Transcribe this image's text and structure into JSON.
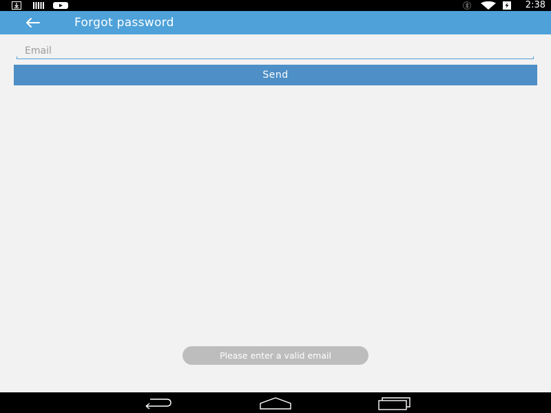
{
  "status_bar": {
    "time": "2:38",
    "left_icons": [
      "download-icon",
      "barcode-icon",
      "youtube-icon"
    ],
    "right_icons": [
      "bluetooth-icon",
      "wifi-icon",
      "battery-charging-icon"
    ]
  },
  "app_bar": {
    "title": "Forgot password",
    "back_icon": "arrow-left-icon",
    "color": "#4ea1d9"
  },
  "form": {
    "email_placeholder": "Email",
    "email_value": "",
    "send_label": "Send",
    "button_color": "#4d8fc6"
  },
  "toast": {
    "message": "Please enter a valid email"
  },
  "nav_bar": {
    "buttons": [
      "back-nav-icon",
      "home-nav-icon",
      "recents-nav-icon"
    ]
  }
}
